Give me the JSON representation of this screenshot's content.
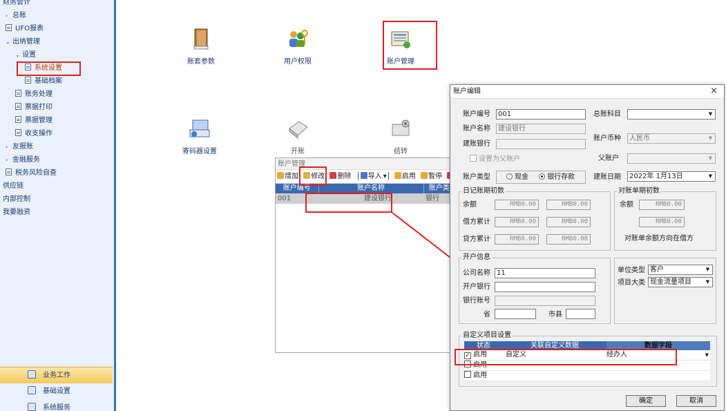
{
  "sidebar": {
    "items": [
      {
        "label": "财务会计",
        "level": 0
      },
      {
        "label": "总账",
        "level": 1,
        "arrow": "›"
      },
      {
        "label": "UFO报表",
        "level": 1
      },
      {
        "label": "出纳管理",
        "level": 1,
        "arrow": "⌄"
      },
      {
        "label": "设置",
        "level": 2,
        "arrow": "⌄"
      },
      {
        "label": "系统设置",
        "level": 3,
        "selected": true
      },
      {
        "label": "基础档案",
        "level": 3
      },
      {
        "label": "账务处理",
        "level": 2
      },
      {
        "label": "票据打印",
        "level": 2
      },
      {
        "label": "票据管理",
        "level": 2
      },
      {
        "label": "收支操作",
        "level": 2
      },
      {
        "label": "友报账",
        "level": 1,
        "arrow": "›"
      },
      {
        "label": "金融服务",
        "level": 1,
        "arrow": "›"
      },
      {
        "label": "税务风险自查",
        "level": 1
      },
      {
        "label": "供应链",
        "level": 0
      },
      {
        "label": "内部控制",
        "level": 0
      },
      {
        "label": "我要融资",
        "level": 0
      }
    ],
    "bottom": [
      {
        "label": "业务工作",
        "active": true
      },
      {
        "label": "基础设置",
        "active": false
      },
      {
        "label": "系统服务",
        "active": false
      }
    ]
  },
  "desktop": {
    "icons": [
      "账套参数",
      "用户权限",
      "账户管理",
      "寄码器设置",
      "开账",
      "结转"
    ]
  },
  "account_panel": {
    "title": "账户管理",
    "toolbar": [
      "增加",
      "修改",
      "删除",
      "导入",
      "启用",
      "暂停"
    ],
    "columns": [
      "账户编号",
      "账户名称",
      "账户类"
    ],
    "rows": [
      [
        "001",
        "建设银行",
        "银行"
      ]
    ]
  },
  "dialog": {
    "title": "账户编辑",
    "close": "×",
    "labels": {
      "acct_no": "账户编号",
      "acct_name": "账户名称",
      "bank": "建账银行",
      "ledger": "总账科目",
      "currency": "账户币种",
      "parent": "父账户",
      "set_parent": "设置为父账户",
      "type": "账户类型",
      "date": "建账日期"
    },
    "values": {
      "acct_no": "001",
      "acct_name": "建设银行",
      "bank": "",
      "ledger": "",
      "currency": "人民币",
      "parent": "",
      "date": "2022年 1月13日"
    },
    "type_options": [
      "现金",
      "银行存款"
    ],
    "type_selected": "银行存款",
    "journal": {
      "title": "日记账期初数",
      "rows": [
        {
          "label": "余额",
          "a": "RMB0.00",
          "b": "RMB0.00"
        },
        {
          "label": "借方累计",
          "a": "RMB0.00",
          "b": "RMB0.00"
        },
        {
          "label": "贷方累计",
          "a": "RMB0.00",
          "b": "RMB0.00"
        }
      ]
    },
    "statement": {
      "title": "对账单期初数",
      "balance_label": "余额",
      "a": "RMB0.00",
      "b": "RMB0.00",
      "note": "对账单余额方向在借方"
    },
    "open_info": {
      "title": "开户信息",
      "company_label": "公司名称",
      "company": "11",
      "bank_label": "开户银行",
      "account_label": "银行账号",
      "province_label": "省",
      "city_label": "市县"
    },
    "unit": {
      "type_label": "单位类型",
      "type_value": "客户",
      "item_label": "项目大类",
      "item_value": "现金流量项目"
    },
    "custom": {
      "title": "自定义项目设置",
      "columns": [
        "状态",
        "关联自定义数据",
        "数据字段"
      ],
      "rows": [
        {
          "checked": true,
          "status": "启用",
          "data": "自定义",
          "field": "经办人"
        },
        {
          "checked": false,
          "status": "启用",
          "data": "",
          "field": ""
        },
        {
          "checked": false,
          "status": "启用",
          "data": "",
          "field": ""
        }
      ]
    },
    "ok": "确定",
    "cancel": "取消"
  },
  "colors": {
    "highlight": "#e02020",
    "header_blue": "#3c68ad",
    "sidebar_bg": "#eaf1fa",
    "nav_text": "#1d3a72"
  }
}
